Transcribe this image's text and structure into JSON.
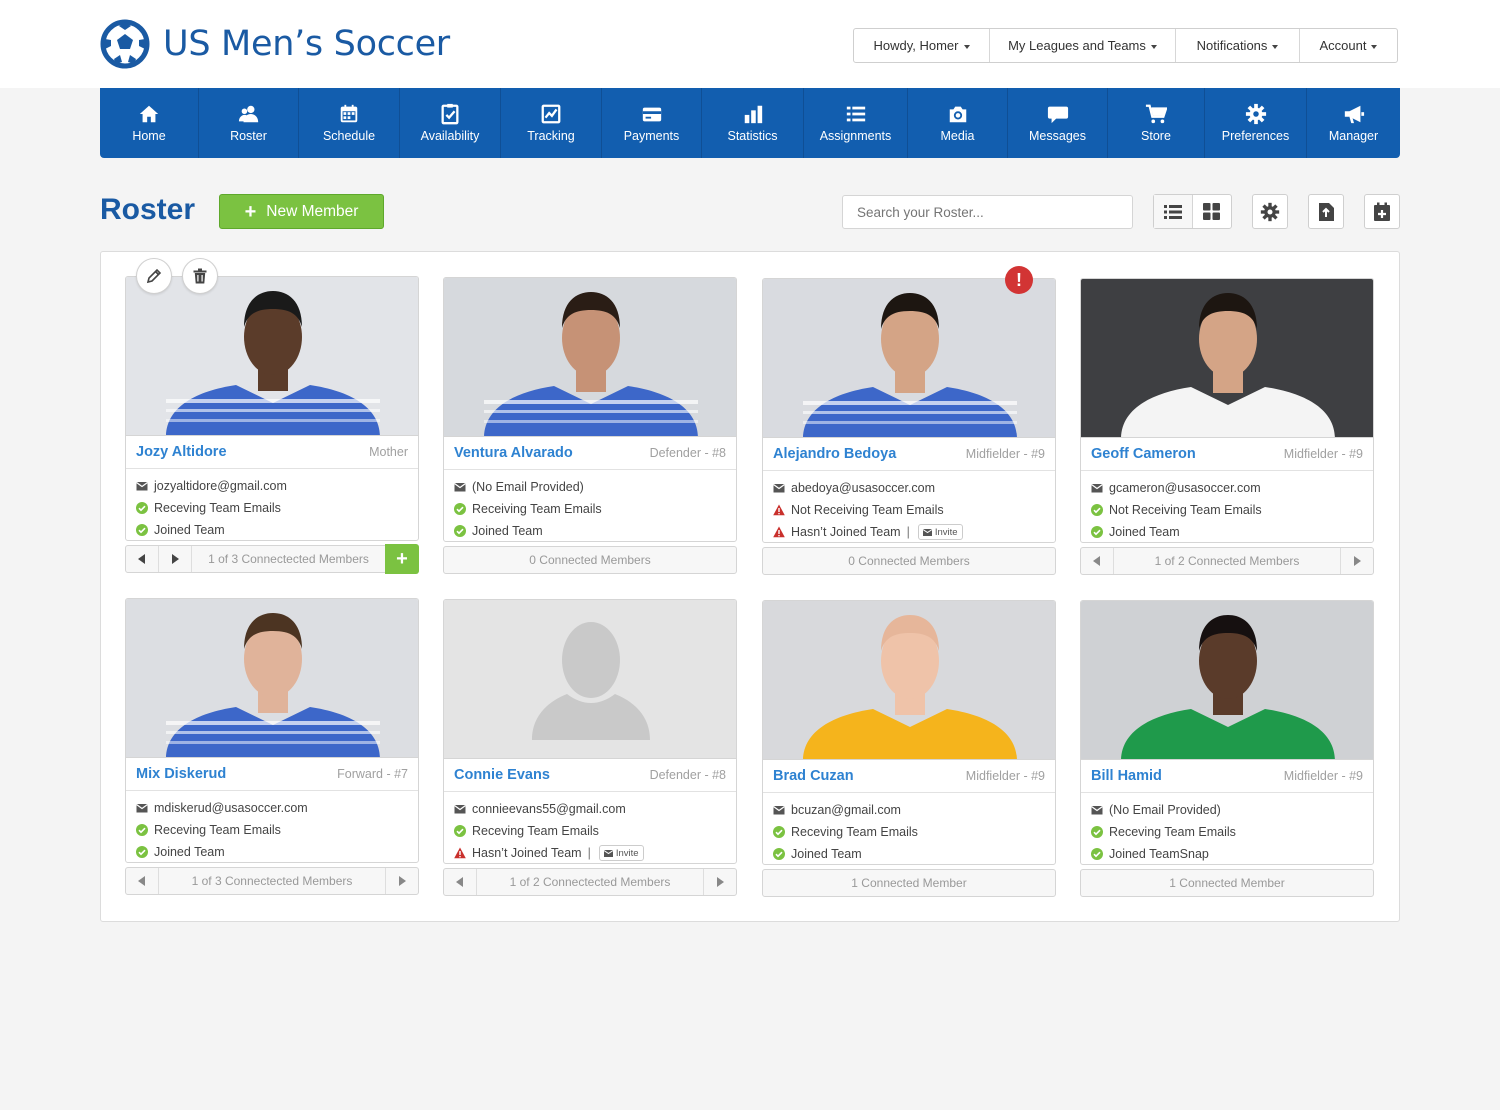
{
  "brand": {
    "title": "US Men’s Soccer",
    "color": "#1a5aa3"
  },
  "user_menu": [
    {
      "label": "Howdy, Homer"
    },
    {
      "label": "My Leagues and Teams"
    },
    {
      "label": "Notifications"
    },
    {
      "label": "Account"
    }
  ],
  "nav": [
    {
      "label": "Home",
      "icon": "home-icon"
    },
    {
      "label": "Roster",
      "icon": "users-icon"
    },
    {
      "label": "Schedule",
      "icon": "calendar-icon"
    },
    {
      "label": "Availability",
      "icon": "checklist-icon"
    },
    {
      "label": "Tracking",
      "icon": "chart-clipboard-icon"
    },
    {
      "label": "Payments",
      "icon": "credit-card-icon"
    },
    {
      "label": "Statistics",
      "icon": "bar-chart-icon"
    },
    {
      "label": "Assignments",
      "icon": "list-icon"
    },
    {
      "label": "Media",
      "icon": "camera-icon"
    },
    {
      "label": "Messages",
      "icon": "speech-bubble-icon"
    },
    {
      "label": "Store",
      "icon": "cart-icon"
    },
    {
      "label": "Preferences",
      "icon": "gear-icon"
    },
    {
      "label": "Manager",
      "icon": "megaphone-icon"
    }
  ],
  "toolbar": {
    "title": "Roster",
    "new_member": "New Member",
    "search_placeholder": "Search your Roster..."
  },
  "members": [
    {
      "name": "Jozy Altidore",
      "role": "Mother",
      "email": "jozyaltidore@gmail.com",
      "email_status": "Receving Team Emails",
      "email_ok": true,
      "join_status": "Joined Team",
      "join_ok": true,
      "footer": "1 of 3 Connectected Members",
      "nav": true,
      "add": true,
      "photo": "player",
      "jersey": "usa"
    },
    {
      "name": "Ventura Alvarado",
      "role": "Defender - #8",
      "email": "(No Email Provided)",
      "email_status": "Receiving Team Emails",
      "email_ok": true,
      "join_status": "Joined Team",
      "join_ok": true,
      "footer": "0 Connected Members",
      "nav": false,
      "photo": "player",
      "jersey": "usa"
    },
    {
      "name": "Alejandro Bedoya",
      "role": "Midfielder - #9",
      "email": "abedoya@usasoccer.com",
      "email_status": "Not Receiving Team Emails",
      "email_ok": false,
      "join_status": "Hasn’t Joined Team",
      "join_ok": false,
      "invite": "Invite",
      "footer": "0 Connected Members",
      "nav": false,
      "alert": "!",
      "photo": "player",
      "jersey": "usa"
    },
    {
      "name": "Geoff Cameron",
      "role": "Midfielder - #9",
      "email": "gcameron@usasoccer.com",
      "email_status": "Not Receiving Team Emails",
      "email_ok": true,
      "join_status": "Joined Team",
      "join_ok": true,
      "footer": "1  of 2 Connected Members",
      "nav": true,
      "photo": "player",
      "jersey": "white"
    },
    {
      "name": "Mix Diskerud",
      "role": "Forward - #7",
      "email": "mdiskerud@usasoccer.com",
      "email_status": "Receving Team Emails",
      "email_ok": true,
      "join_status": "Joined Team",
      "join_ok": true,
      "footer": "1 of 3 Connectected Members",
      "nav": true,
      "photo": "player",
      "jersey": "usa"
    },
    {
      "name": "Connie Evans",
      "role": "Defender - #8",
      "email": "connieevans55@gmail.com",
      "email_status": "Receving Team Emails",
      "email_ok": true,
      "join_status": "Hasn’t Joined Team",
      "join_ok": false,
      "invite": "Invite",
      "footer": "1 of 2 Connectected Members",
      "nav": true,
      "photo": "placeholder"
    },
    {
      "name": "Brad Cuzan",
      "role": "Midfielder - #9",
      "email": "bcuzan@gmail.com",
      "email_status": "Receving Team Emails",
      "email_ok": true,
      "join_status": "Joined Team",
      "join_ok": true,
      "footer": "1 Connected Member",
      "nav": false,
      "photo": "player",
      "jersey": "yellow"
    },
    {
      "name": "Bill Hamid",
      "role": "Midfielder - #9",
      "email": "(No Email Provided)",
      "email_status": "Receving Team Emails",
      "email_ok": true,
      "join_status": "Joined TeamSnap",
      "join_ok": true,
      "footer": "1 Connected Member",
      "nav": false,
      "photo": "player",
      "jersey": "green"
    }
  ],
  "colors": {
    "nav": "#125eaf",
    "accent_green": "#7bc241",
    "link": "#2e82d1",
    "ok": "#7bc241",
    "warn": "#c9302c"
  }
}
